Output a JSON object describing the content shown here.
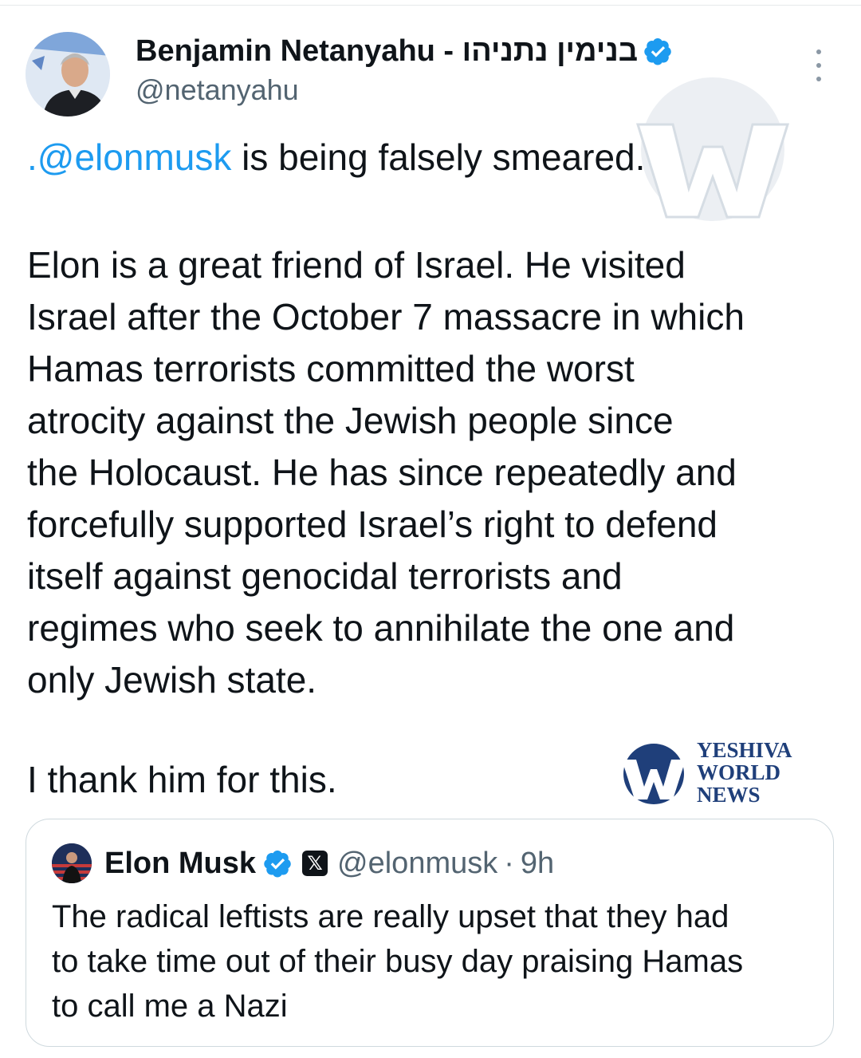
{
  "tweet": {
    "author": {
      "display_name": "Benjamin Netanyahu - בנימין נתניהו",
      "handle": "@netanyahu",
      "verified": true,
      "avatar_icon": "profile-photo-netanyahu"
    },
    "text": {
      "mention": ".@elonmusk",
      "first_line_rest": " is being falsely smeared.",
      "paragraph_lines": [
        "Elon is a great friend of Israel.  He visited",
        "Israel after the October 7 massacre in which",
        "Hamas terrorists committed the worst",
        "atrocity against the Jewish people since",
        "the Holocaust. He has since repeatedly and",
        "forcefully supported Israel’s right to defend",
        "itself against genocidal terrorists and",
        "regimes who seek to annihilate the one and",
        "only Jewish state."
      ],
      "closing": "I thank him for this."
    },
    "more_icon": "vertical-ellipsis-icon"
  },
  "quoted_tweet": {
    "display_name": "Elon Musk",
    "verified": true,
    "affiliate_badge": "𝕏",
    "handle": "@elonmusk",
    "separator": "·",
    "time": "9h",
    "text_lines": [
      "The radical leftists are really upset that they had",
      "to take time out of their busy day praising Hamas",
      "to call me a Nazi"
    ]
  },
  "watermark": {
    "logo_lines": [
      "YESHIVA",
      "WORLD",
      "NEWS"
    ]
  },
  "colors": {
    "text": "#0f1419",
    "secondary": "#536471",
    "link": "#1d9bf0",
    "verified": "#1d9bf0",
    "border": "#cfd9de",
    "ywn_blue": "#1f3f7a"
  }
}
